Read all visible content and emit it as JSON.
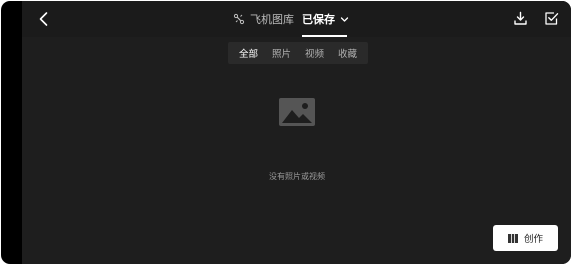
{
  "header": {
    "back_icon": "chevron-left-icon",
    "gallery_tab_icon": "drone-icon",
    "gallery_tab_label": "飞机图库",
    "saved_tab_label": "已保存",
    "saved_tab_dropdown_icon": "chevron-down-icon",
    "export_icon": "download-icon",
    "select_icon": "checkbox-icon"
  },
  "filters": {
    "items": [
      {
        "label": "全部",
        "active": true
      },
      {
        "label": "照片",
        "active": false
      },
      {
        "label": "视频",
        "active": false
      },
      {
        "label": "收藏",
        "active": false
      }
    ]
  },
  "empty_state": {
    "icon": "image-placeholder-icon",
    "message": "没有照片或视频"
  },
  "create_button": {
    "icon": "film-icon",
    "label": "创作"
  },
  "colors": {
    "background": "#1e1e1e",
    "topbar": "#1b1b1b",
    "filter_bar": "#2a2a2a",
    "text_active": "#ffffff",
    "text_muted": "#b0b0b0",
    "button_bg": "#ffffff"
  }
}
